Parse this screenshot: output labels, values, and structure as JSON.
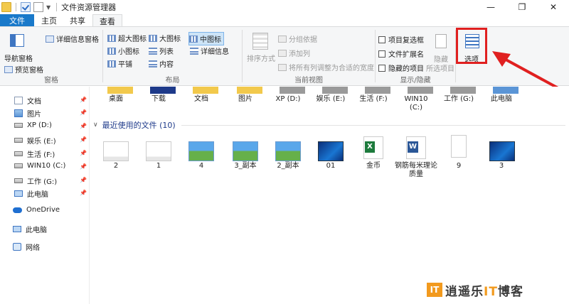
{
  "window": {
    "title": "文件资源管理器"
  },
  "tabs": [
    {
      "label": "文件"
    },
    {
      "label": "主页"
    },
    {
      "label": "共享"
    },
    {
      "label": "查看"
    }
  ],
  "ribbon": {
    "pane": {
      "nav_pane": "导航窗格",
      "preview_pane": "预览窗格",
      "details_pane": "详细信息窗格",
      "group_label": "窗格"
    },
    "layout": {
      "items": [
        "超大图标",
        "大图标",
        "中图标",
        "小图标",
        "列表",
        "详细信息",
        "平铺",
        "内容"
      ],
      "selected": "中图标",
      "group_label": "布局"
    },
    "current_view": {
      "sort": "排序方式",
      "group_by": "分组依据",
      "add_column": "添加列",
      "fit_columns": "将所有列调整为合适的宽度",
      "group_label": "当前视图"
    },
    "show_hide": {
      "item_checkboxes": "项目复选框",
      "file_extensions": "文件扩展名",
      "hidden_items": "隐藏的项目",
      "hide": "隐藏",
      "selected_items": "所选项目",
      "group_label": "显示/隐藏"
    },
    "options": "选项"
  },
  "nav": {
    "quick_access": [
      {
        "label": "文档"
      },
      {
        "label": "图片"
      },
      {
        "label": "XP (D:)"
      },
      {
        "label": "娱乐 (E:)"
      },
      {
        "label": "生活 (F:)"
      },
      {
        "label": "WIN10 (C:)"
      },
      {
        "label": "工作 (G:)"
      },
      {
        "label": "此电脑"
      }
    ],
    "onedrive": "OneDrive",
    "this_pc": "此电脑",
    "network": "网络"
  },
  "frequent_folders": [
    "桌面",
    "下载",
    "文档",
    "图片",
    "XP (D:)",
    "娱乐 (E:)",
    "生活 (F:)",
    "WIN10\n(C:)",
    "工作 (G:)",
    "此电脑"
  ],
  "recent_section": {
    "title": "最近使用的文件 (10)"
  },
  "recent_files": [
    {
      "name": "2"
    },
    {
      "name": "1"
    },
    {
      "name": "4"
    },
    {
      "name": "3_副本"
    },
    {
      "name": "2_副本"
    },
    {
      "name": "01"
    },
    {
      "name": "金币"
    },
    {
      "name": "钢筋每米理论质量"
    },
    {
      "name": "9"
    },
    {
      "name": "3"
    }
  ],
  "watermark": {
    "logo": "IT",
    "text_a": "逍遥乐",
    "text_accent": "IT",
    "text_b": "博客"
  }
}
